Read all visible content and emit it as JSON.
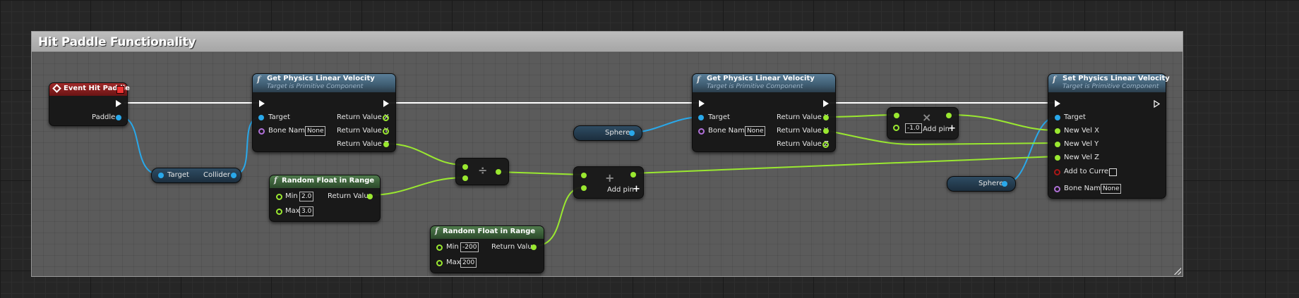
{
  "comment": {
    "title": "Hit Paddle Functionality"
  },
  "event_node": {
    "title": "Event Hit Paddle",
    "pin_paddle": "Paddle"
  },
  "cast_node": {
    "left_label": "Target",
    "right_label": "Collider"
  },
  "get_vel_1": {
    "title": "Get Physics Linear Velocity",
    "subtitle": "Target is Primitive Component",
    "target": "Target",
    "bone_name_label": "Bone Name",
    "bone_name_value": "None",
    "ret_x": "Return Value X",
    "ret_y": "Return Value Y",
    "ret_z": "Return Value Z"
  },
  "random_1": {
    "title": "Random Float in Range",
    "min_label": "Min",
    "min_value": "2.0",
    "max_label": "Max",
    "max_value": "3.0",
    "ret": "Return Value"
  },
  "random_2": {
    "title": "Random Float in Range",
    "min_label": "Min",
    "min_value": "-200",
    "max_label": "Max",
    "max_value": "200",
    "ret": "Return Value"
  },
  "divide_node": {
    "symbol": "÷"
  },
  "add_node": {
    "symbol": "+",
    "add_pin": "Add pin"
  },
  "sphere_1": {
    "label": "Sphere"
  },
  "sphere_2": {
    "label": "Sphere"
  },
  "get_vel_2": {
    "title": "Get Physics Linear Velocity",
    "subtitle": "Target is Primitive Component",
    "target": "Target",
    "bone_name_label": "Bone Name",
    "bone_name_value": "None",
    "ret_x": "Return Value X",
    "ret_y": "Return Value Y",
    "ret_z": "Return Value Z"
  },
  "multiply_node": {
    "symbol": "×",
    "value": "-1.0",
    "add_pin": "Add pin"
  },
  "set_vel": {
    "title": "Set Physics Linear Velocity",
    "subtitle": "Target is Primitive Component",
    "target": "Target",
    "vx": "New Vel X",
    "vy": "New Vel Y",
    "vz": "New Vel Z",
    "add_current": "Add to Current",
    "bone_name_label": "Bone Name",
    "bone_name_value": "None"
  },
  "colors": {
    "exec": "#ffffff",
    "object_pin": "#29a8ea",
    "float_pin": "#9ae830",
    "name_pin": "#b070d8",
    "bool_pin": "#aa1616",
    "function_header": "#3f5d72",
    "pure_header": "#2c4a2b",
    "event_header": "#a02a2a"
  }
}
